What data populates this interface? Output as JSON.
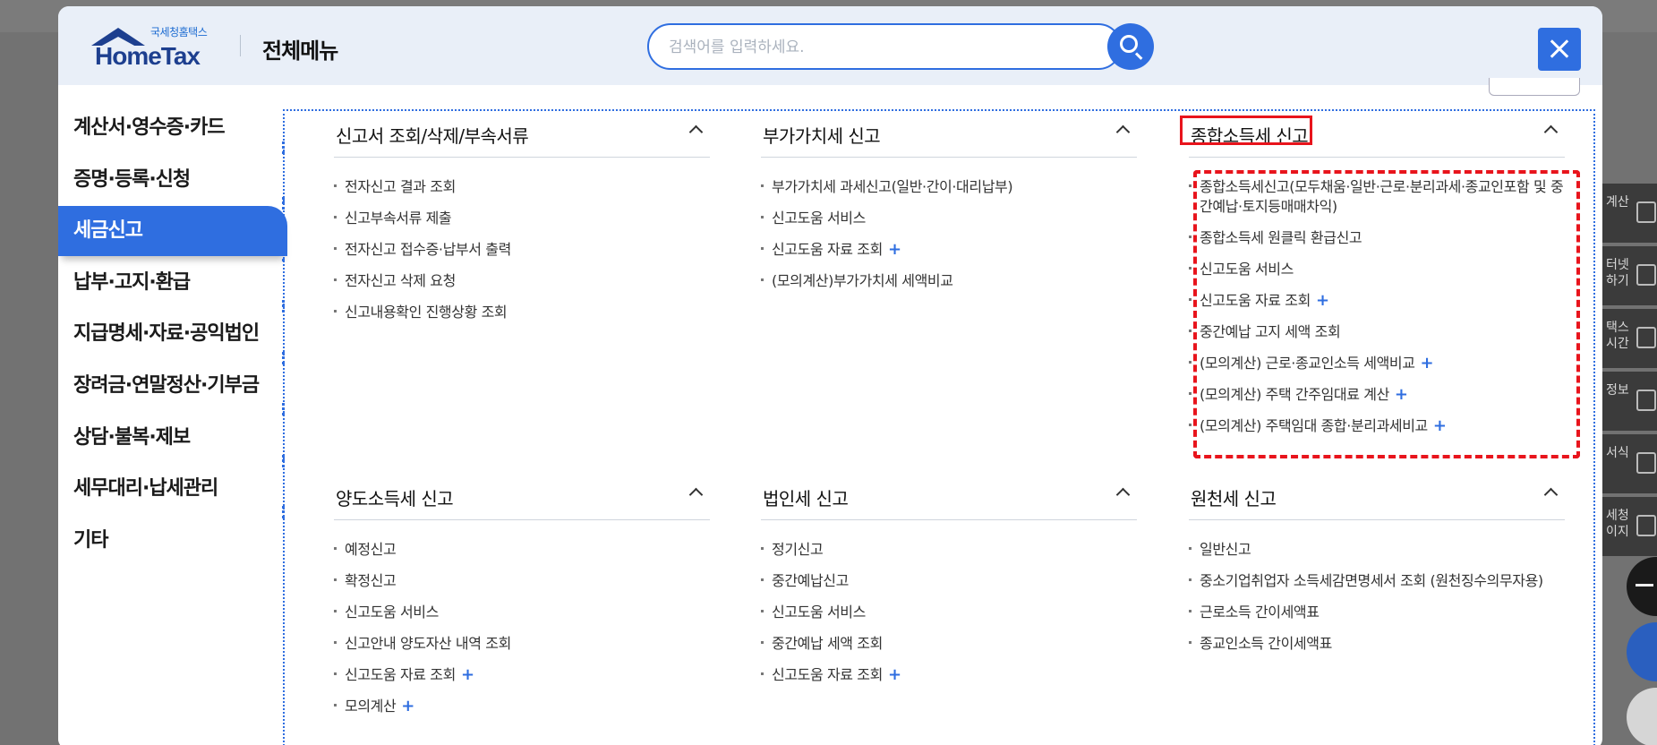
{
  "quick_menu": [
    {
      "label": "계산",
      "icon": "calculator-icon"
    },
    {
      "label": "터넷\n하기",
      "icon": "headset-icon"
    },
    {
      "label": "택스\n시간",
      "icon": "clock-icon"
    },
    {
      "label": "정보",
      "icon": "pen-icon"
    },
    {
      "label": "서식",
      "icon": "document-icon"
    },
    {
      "label": "세청\n이지",
      "icon": "building-icon"
    }
  ],
  "header": {
    "logo_small": "국세청홈택스",
    "logo_big": "HomeTax",
    "title": "전체메뉴",
    "search_placeholder": "검색어를 입력하세요."
  },
  "left_nav": [
    {
      "label": "계산서·영수증·카드",
      "active": false
    },
    {
      "label": "증명·등록·신청",
      "active": false
    },
    {
      "label": "세금신고",
      "active": true
    },
    {
      "label": "납부·고지·환급",
      "active": false
    },
    {
      "label": "지급명세·자료·공익법인",
      "active": false
    },
    {
      "label": "장려금·연말정산·기부금",
      "active": false
    },
    {
      "label": "상담·불복·제보",
      "active": false
    },
    {
      "label": "세무대리·납세관리",
      "active": false
    },
    {
      "label": "기타",
      "active": false
    }
  ],
  "sections": [
    {
      "title": "신고서 조회/삭제/부속서류",
      "items": [
        {
          "label": "전자신고 결과 조회",
          "plus": false
        },
        {
          "label": "신고부속서류 제출",
          "plus": false
        },
        {
          "label": "전자신고 접수증·납부서 출력",
          "plus": false
        },
        {
          "label": "전자신고 삭제 요청",
          "plus": false
        },
        {
          "label": "신고내용확인 진행상황 조회",
          "plus": false
        }
      ]
    },
    {
      "title": "부가가치세 신고",
      "items": [
        {
          "label": "부가가치세 과세신고(일반·간이·대리납부)",
          "plus": false
        },
        {
          "label": "신고도움 서비스",
          "plus": false
        },
        {
          "label": "신고도움 자료 조회",
          "plus": true
        },
        {
          "label": "(모의계산)부가가치세 세액비교",
          "plus": false
        }
      ]
    },
    {
      "title": "종합소득세 신고",
      "items": [
        {
          "label": "종합소득세신고(모두채움·일반·근로·분리과세·종교인포함 및 중간예납·토지등매매차익)",
          "plus": false
        },
        {
          "label": "종합소득세 원클릭 환급신고",
          "plus": false
        },
        {
          "label": "신고도움 서비스",
          "plus": false
        },
        {
          "label": "신고도움 자료 조회",
          "plus": true
        },
        {
          "label": "중간예납 고지 세액 조회",
          "plus": false
        },
        {
          "label": "(모의계산) 근로·종교인소득 세액비교",
          "plus": true
        },
        {
          "label": "(모의계산) 주택 간주임대료 계산",
          "plus": true
        },
        {
          "label": "(모의계산) 주택임대 종합·분리과세비교",
          "plus": true
        }
      ]
    },
    {
      "title": "양도소득세 신고",
      "items": [
        {
          "label": "예정신고",
          "plus": false
        },
        {
          "label": "확정신고",
          "plus": false
        },
        {
          "label": "신고도움 서비스",
          "plus": false
        },
        {
          "label": "신고안내 양도자산 내역 조회",
          "plus": false
        },
        {
          "label": "신고도움 자료 조회",
          "plus": true
        },
        {
          "label": "모의계산",
          "plus": true
        }
      ]
    },
    {
      "title": "법인세 신고",
      "items": [
        {
          "label": "정기신고",
          "plus": false
        },
        {
          "label": "중간예납신고",
          "plus": false
        },
        {
          "label": "신고도움 서비스",
          "plus": false
        },
        {
          "label": "중간예납 세액 조회",
          "plus": false
        },
        {
          "label": "신고도움 자료 조회",
          "plus": true
        }
      ]
    },
    {
      "title": "원천세 신고",
      "items": [
        {
          "label": "일반신고",
          "plus": false
        },
        {
          "label": "중소기업취업자 소득세감면명세서 조회 (원천징수의무자용)",
          "plus": false
        },
        {
          "label": "근로소득 간이세액표",
          "plus": false
        },
        {
          "label": "종교인소득 간이세액표",
          "plus": false
        }
      ]
    }
  ],
  "colors": {
    "accent": "#2f6ee0",
    "highlight": "#e8141c"
  }
}
